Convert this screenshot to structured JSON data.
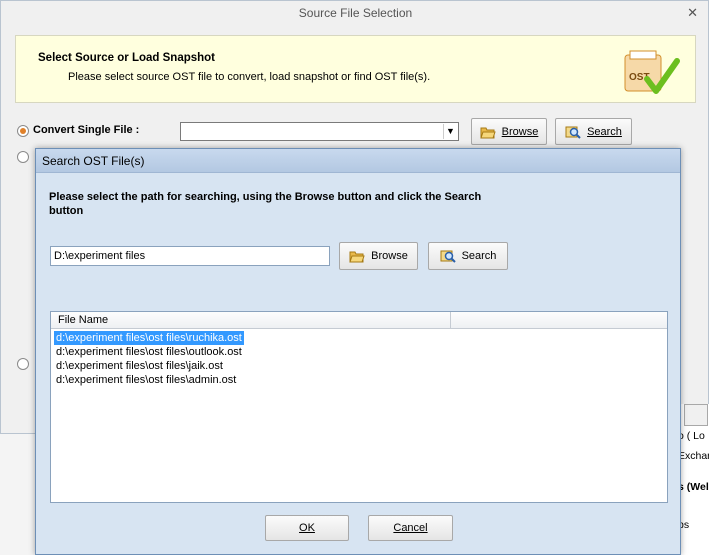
{
  "outer": {
    "title": "Source File Selection",
    "close": "✕",
    "banner_title": "Select Source or Load Snapshot",
    "banner_sub": "Please select source OST file to convert, load snapshot or find OST file(s).",
    "logo_text": "OST",
    "convert_label": "Convert Single File :",
    "combo_value": "",
    "browse_label": "Browse",
    "search_label": "Search",
    "right_fragments": [
      "o ( Lo",
      "Exchar",
      "s (Wel",
      "ps"
    ]
  },
  "dialog": {
    "title": "Search OST File(s)",
    "instruction": "Please select the path for searching, using the Browse button and click the Search button",
    "path_value": "D:\\experiment files",
    "browse_label": "Browse",
    "search_label": "Search",
    "column_header": "File Name",
    "files": [
      "d:\\experiment files\\ost files\\ruchika.ost",
      "d:\\experiment files\\ost files\\outlook.ost",
      "d:\\experiment files\\ost files\\jaik.ost",
      "d:\\experiment files\\ost files\\admin.ost"
    ],
    "selected_index": 0,
    "ok_label": "OK",
    "cancel_label": "Cancel"
  },
  "colors": {
    "accent": "#e0812a",
    "selection": "#3399ff",
    "banner": "#ffffde",
    "dialog_bg": "#d7e4f2"
  },
  "icons": {
    "browse": "folder-open-icon",
    "search": "magnifier-icon",
    "logo": "ost-checkmark-icon"
  }
}
